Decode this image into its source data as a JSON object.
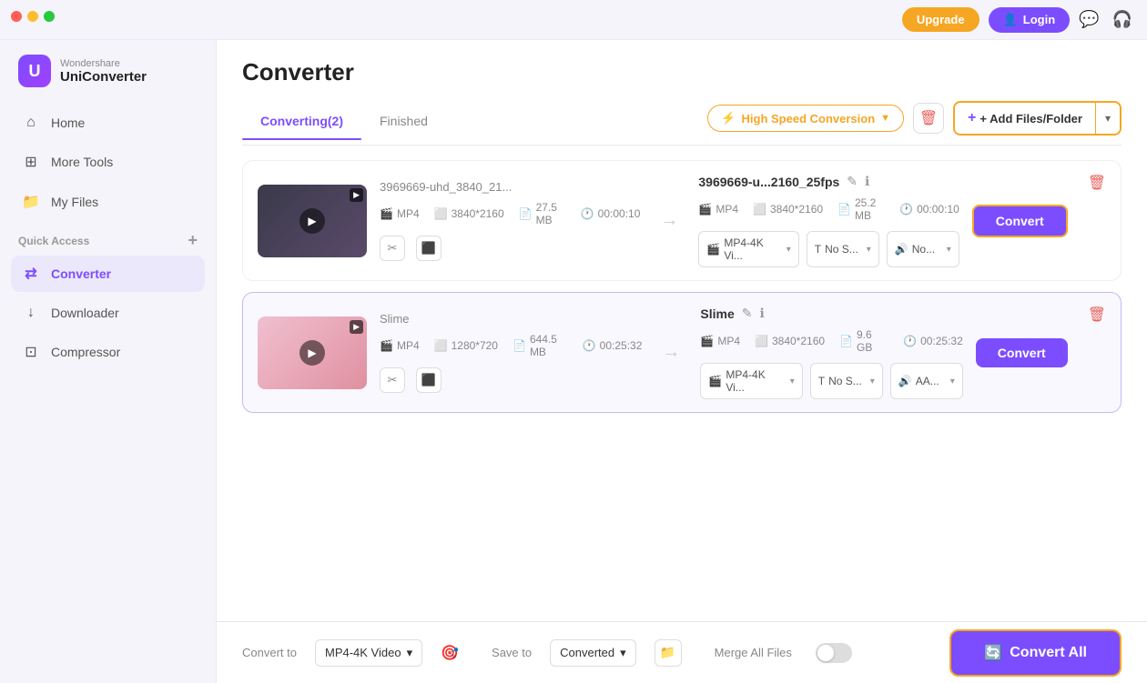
{
  "window": {
    "controls": [
      "close",
      "min",
      "max"
    ]
  },
  "topbar": {
    "upgrade_label": "Upgrade",
    "login_label": "Login"
  },
  "sidebar": {
    "logo": {
      "brand": "Wondershare",
      "product": "UniConverter"
    },
    "nav_items": [
      {
        "id": "home",
        "label": "Home",
        "icon": "⌂"
      },
      {
        "id": "more-tools",
        "label": "More Tools",
        "icon": "⊞"
      },
      {
        "id": "my-files",
        "label": "My Files",
        "icon": "☰"
      }
    ],
    "quick_access_label": "Quick Access",
    "quick_access_add": "+",
    "sub_items": [
      {
        "id": "converter",
        "label": "Converter",
        "icon": "⇄",
        "active": true
      },
      {
        "id": "downloader",
        "label": "Downloader",
        "icon": "↓"
      },
      {
        "id": "compressor",
        "label": "Compressor",
        "icon": "⊡"
      }
    ]
  },
  "content": {
    "page_title": "Converter",
    "tabs": [
      {
        "id": "converting",
        "label": "Converting(2)",
        "active": true
      },
      {
        "id": "finished",
        "label": "Finished",
        "active": false
      }
    ],
    "high_speed": {
      "label": "High Speed Conversion",
      "arrow": "▼"
    },
    "add_files": {
      "label": "+ Add Files/Folder",
      "arrow": "▾"
    },
    "files": [
      {
        "id": "file1",
        "thumb_color": "#3a3a4a",
        "source_name": "3969669-uhd_3840_21...",
        "source_format": "MP4",
        "source_resolution": "3840*2160",
        "source_size": "27.5 MB",
        "source_duration": "00:00:10",
        "target_name": "3969669-u...2160_25fps",
        "target_format": "MP4",
        "target_resolution": "3840*2160",
        "target_size": "25.2 MB",
        "target_duration": "00:00:10",
        "format_select": "MP4-4K Vi...",
        "subtitle_select": "No S...",
        "audio_select": "No...",
        "convert_btn_label": "Convert",
        "selected": false
      },
      {
        "id": "file2",
        "thumb_color": "#e8a0b0",
        "source_name": "Slime",
        "source_format": "MP4",
        "source_resolution": "1280*720",
        "source_size": "644.5 MB",
        "source_duration": "00:25:32",
        "target_name": "Slime",
        "target_format": "MP4",
        "target_resolution": "3840*2160",
        "target_size": "9.6 GB",
        "target_duration": "00:25:32",
        "format_select": "MP4-4K Vi...",
        "subtitle_select": "No S...",
        "audio_select": "AA...",
        "convert_btn_label": "Convert",
        "selected": true
      }
    ]
  },
  "bottom_bar": {
    "convert_to_label": "Convert to",
    "convert_to_value": "MP4-4K Video",
    "convert_to_arrow": "▾",
    "save_to_label": "Save to",
    "save_to_value": "Converted",
    "save_to_arrow": "▾",
    "merge_label": "Merge All Files",
    "convert_all_label": "Convert All"
  }
}
